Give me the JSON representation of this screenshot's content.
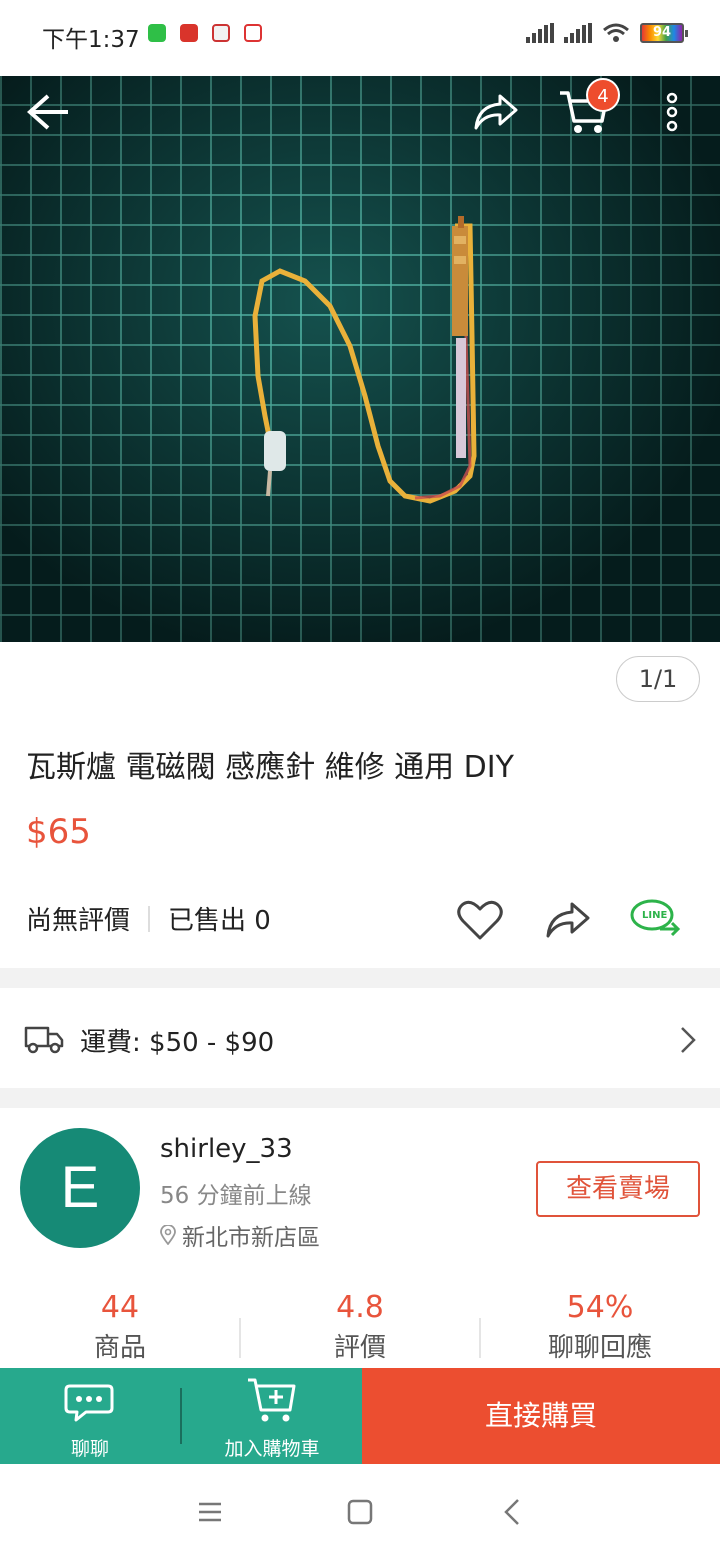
{
  "status_bar": {
    "time": "下午1:37",
    "battery": "94"
  },
  "gallery": {
    "counter": "1/1",
    "cart_count": "4"
  },
  "product": {
    "title": "瓦斯爐 電磁閥 感應針 維修 通用 DIY",
    "price": "$65",
    "rating": "尚無評價",
    "sold": "已售出 0",
    "line_label": "LINE"
  },
  "shipping": {
    "label": "運費: $50 - $90"
  },
  "seller": {
    "avatar_letter": "E",
    "name": "shirley_33",
    "online": "56 分鐘前上線",
    "location": "新北市新店區",
    "view_shop": "查看賣場"
  },
  "stats": [
    {
      "value": "44",
      "label": "商品"
    },
    {
      "value": "4.8",
      "label": "評價"
    },
    {
      "value": "54%",
      "label": "聊聊回應"
    }
  ],
  "bottom_bar": {
    "chat": "聊聊",
    "add_to_cart": "加入購物車",
    "buy_now": "直接購買"
  },
  "colors": {
    "accent": "#ee4d2d",
    "green": "#27a98d",
    "price": "#e8543c"
  }
}
